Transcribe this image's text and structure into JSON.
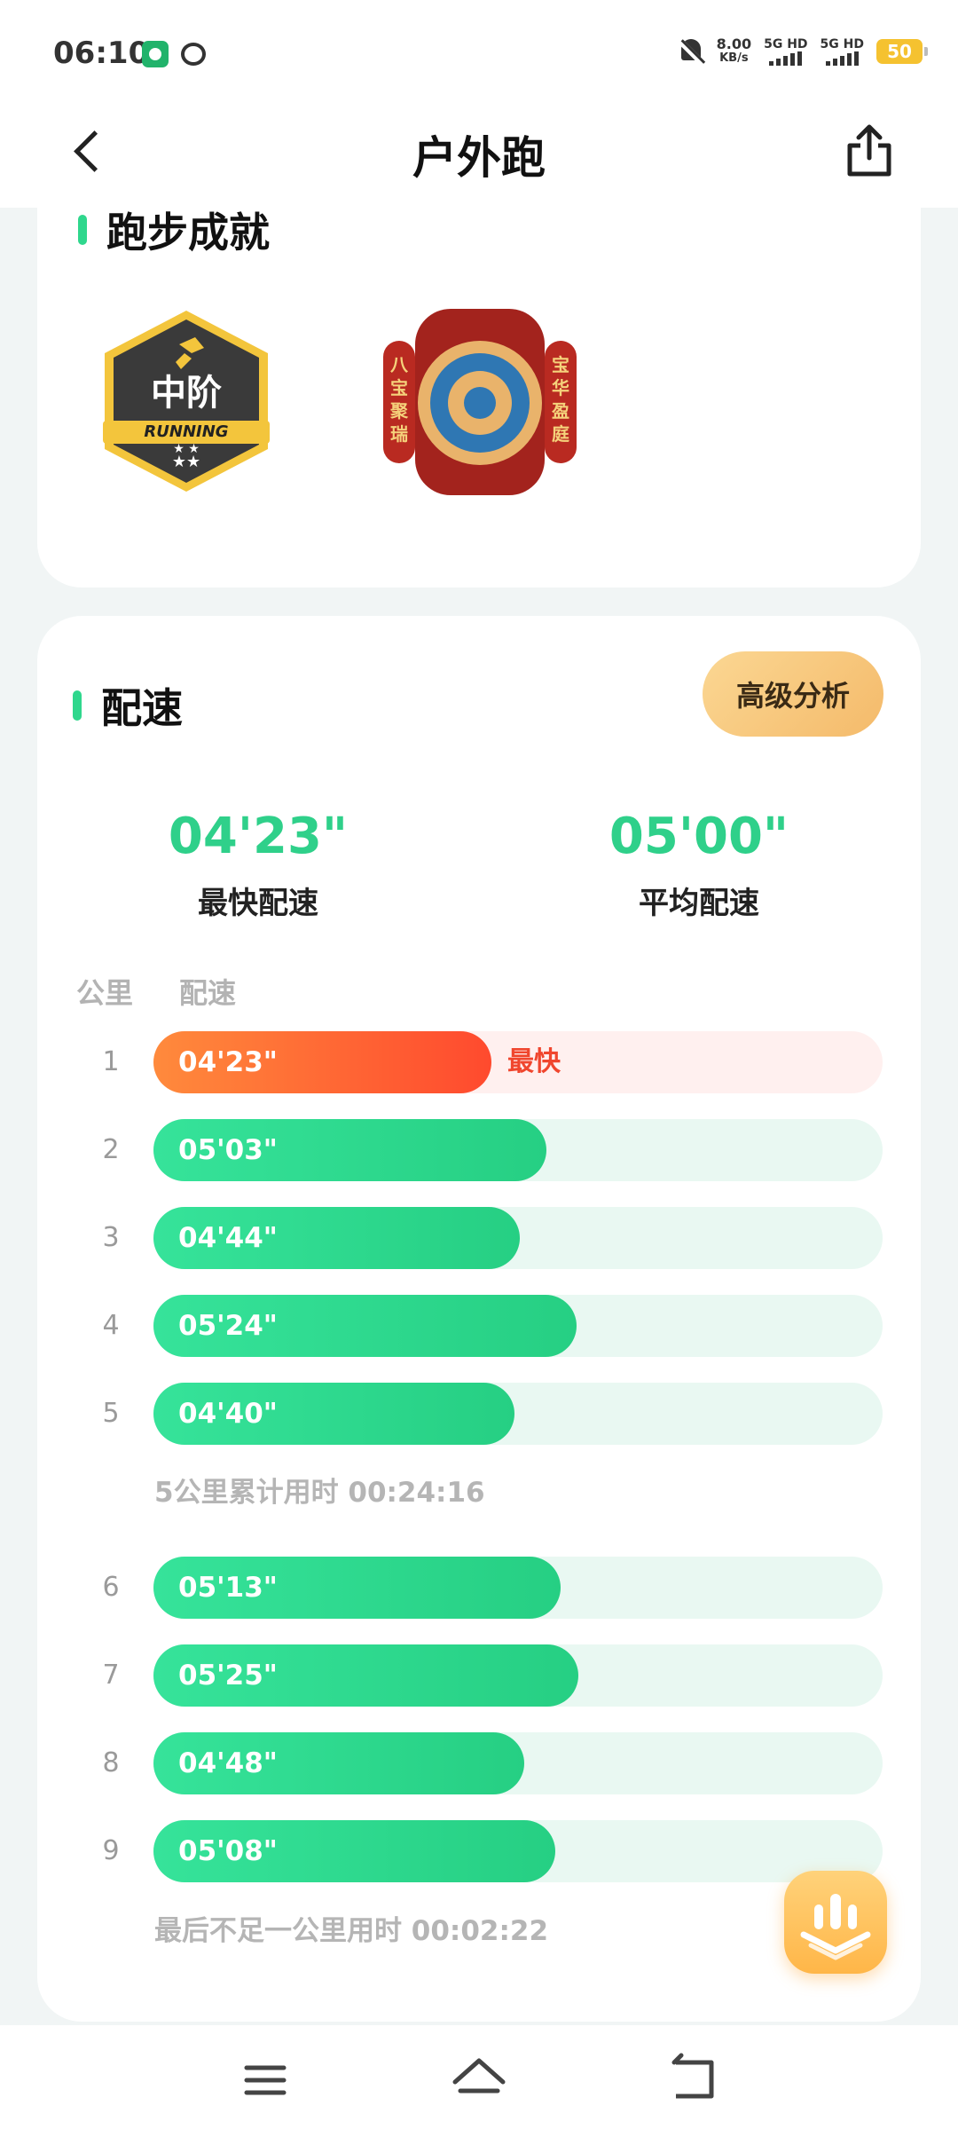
{
  "status_bar": {
    "time": "06:10",
    "net_speed_value": "8.00",
    "net_speed_unit": "KB/s",
    "sim1": "5G HD",
    "sim2": "5G HD",
    "battery": "50"
  },
  "header": {
    "title": "户外跑",
    "back_icon": "chevron-left-icon",
    "share_icon": "share-icon"
  },
  "achievements": {
    "title": "跑步成就",
    "badges": [
      {
        "name": "intermediate-running-badge",
        "main_text": "中阶",
        "sub_text": "RUNNING",
        "stars": "★★"
      },
      {
        "name": "treasure-badge",
        "left_text": "八宝聚瑞",
        "right_text": "宝华盈庭"
      }
    ]
  },
  "pace": {
    "title": "配速",
    "advanced_button": "高级分析",
    "fastest_value": "04'23\"",
    "fastest_label": "最快配速",
    "average_value": "05'00\"",
    "average_label": "平均配速",
    "col_km": "公里",
    "col_pace": "配速",
    "fastest_tag": "最快",
    "rows": [
      {
        "km": "1",
        "pace": "04'23\"",
        "fraction": 0.463,
        "fastest": true
      },
      {
        "km": "2",
        "pace": "05'03\"",
        "fraction": 0.539,
        "fastest": false
      },
      {
        "km": "3",
        "pace": "04'44\"",
        "fraction": 0.502,
        "fastest": false
      },
      {
        "km": "4",
        "pace": "05'24\"",
        "fraction": 0.58,
        "fastest": false
      },
      {
        "km": "5",
        "pace": "04'40\"",
        "fraction": 0.495,
        "fastest": false
      },
      {
        "km": "6",
        "pace": "05'13\"",
        "fraction": 0.558,
        "fastest": false
      },
      {
        "km": "7",
        "pace": "05'25\"",
        "fraction": 0.583,
        "fastest": false
      },
      {
        "km": "8",
        "pace": "04'48\"",
        "fraction": 0.509,
        "fastest": false
      },
      {
        "km": "9",
        "pace": "05'08\"",
        "fraction": 0.551,
        "fastest": false
      }
    ],
    "summary_5km_label": "5公里累计用时",
    "summary_5km_value": "00:24:16",
    "summary_last_label": "最后不足一公里用时",
    "summary_last_value": "00:02:22"
  },
  "float_button_icon": "voice-broadcast-icon",
  "nav": {
    "menu_icon": "menu-icon",
    "home_icon": "home-icon",
    "back_icon": "return-icon"
  },
  "colors": {
    "accent_green": "#2fd08a",
    "fast_orange": "#ff4a2e",
    "advanced_button": "#f4ba6a"
  }
}
